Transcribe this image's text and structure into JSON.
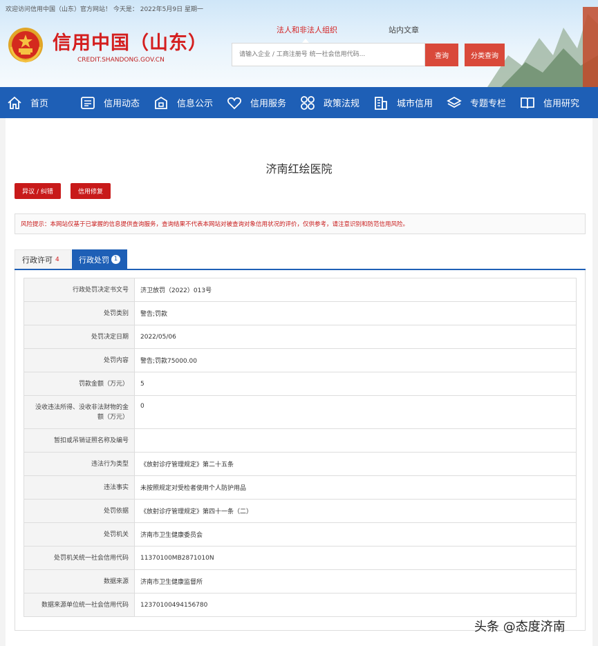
{
  "header": {
    "welcome": "欢迎访问信用中国（山东）官方网站！ 今天是： 2022年5月9日 星期一",
    "site_title": "信用中国（山东）",
    "site_url": "CREDIT.SHANDONG.GOV.CN",
    "search_tabs": [
      "法人和非法人组织",
      "站内文章"
    ],
    "search_placeholder": "请输入企业 / 工商注册号 统一社会信用代码...",
    "search_button": "查询",
    "category_button": "分类查询"
  },
  "nav": {
    "items": [
      {
        "label": "首页",
        "icon": "home-icon"
      },
      {
        "label": "信用动态",
        "icon": "news-icon"
      },
      {
        "label": "信息公示",
        "icon": "publicity-icon"
      },
      {
        "label": "信用服务",
        "icon": "heart-icon"
      },
      {
        "label": "政策法规",
        "icon": "grid-icon"
      },
      {
        "label": "城市信用",
        "icon": "building-icon"
      },
      {
        "label": "专题专栏",
        "icon": "layers-icon"
      },
      {
        "label": "信用研究",
        "icon": "book-icon"
      }
    ]
  },
  "main": {
    "hospital_name": "济南红绘医院",
    "objection_button": "异议 / 纠错",
    "repair_button": "信用修复",
    "risk_notice": "风险提示：本网站仅基于已掌握的信息提供查询服务，查询结果不代表本网站对被查询对象信用状况的评价，仅供参考，请注意识别和防范信用风险。",
    "tabs": [
      {
        "label": "行政许可",
        "count": "4"
      },
      {
        "label": "行政处罚",
        "count": "1"
      }
    ],
    "rows": [
      {
        "label": "行政处罚决定书文号",
        "value": "济卫放罚（2022）013号"
      },
      {
        "label": "处罚类别",
        "value": "警告;罚款"
      },
      {
        "label": "处罚决定日期",
        "value": "2022/05/06"
      },
      {
        "label": "处罚内容",
        "value": "警告;罚款75000.00"
      },
      {
        "label": "罚款金额（万元）",
        "value": "5"
      },
      {
        "label": "没收违法所得、没收非法财物的金额（万元）",
        "value": "0"
      },
      {
        "label": "暂扣或吊销证照名称及编号",
        "value": ""
      },
      {
        "label": "违法行为类型",
        "value": "《放射诊疗管理规定》第二十五条"
      },
      {
        "label": "违法事实",
        "value": "未按照规定对受检者使用个人防护用品"
      },
      {
        "label": "处罚依据",
        "value": "《放射诊疗管理规定》第四十一条（二）"
      },
      {
        "label": "处罚机关",
        "value": "济南市卫生健康委员会"
      },
      {
        "label": "处罚机关统一社会信用代码",
        "value": "11370100MB2871010N"
      },
      {
        "label": "数据来源",
        "value": "济南市卫生健康监督所"
      },
      {
        "label": "数据来源单位统一社会信用代码",
        "value": "12370100494156780"
      }
    ]
  },
  "watermark": "头条 @态度济南",
  "colors": {
    "brand_red": "#d41f1f",
    "nav_blue": "#1e5fb6",
    "button_red": "#c81a1a"
  }
}
